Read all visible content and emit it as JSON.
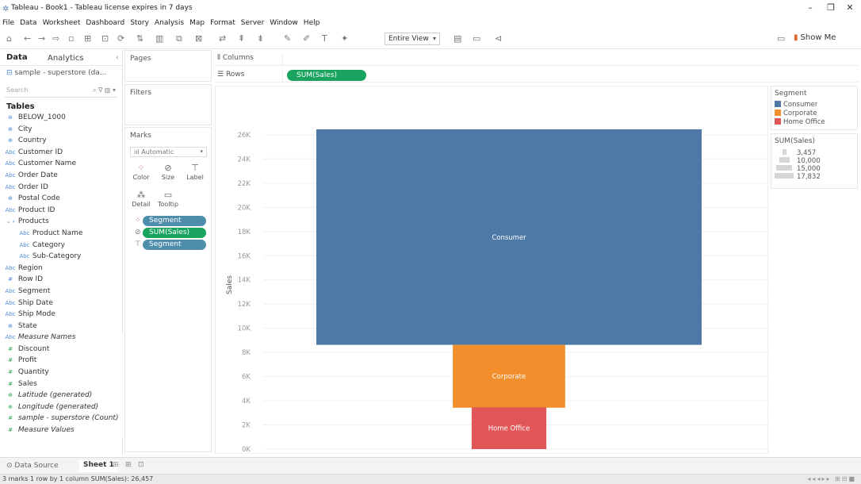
{
  "window": {
    "title": "Tableau - Book1 - Tableau license expires in 7 days",
    "controls": [
      "–",
      "❐",
      "✕"
    ]
  },
  "menu": [
    "File",
    "Data",
    "Worksheet",
    "Dashboard",
    "Story",
    "Analysis",
    "Map",
    "Format",
    "Server",
    "Window",
    "Help"
  ],
  "toolbar": {
    "view_select": "Entire View",
    "show_me": "Show Me"
  },
  "data_pane": {
    "tab_data": "Data",
    "tab_analytics": "Analytics",
    "datasource": "sample - superstore (da...",
    "search_placeholder": "Search",
    "tables_header": "Tables",
    "fields": [
      {
        "name": "BELOW_1000",
        "kind": "param",
        "indent": 0
      },
      {
        "name": "City",
        "kind": "geo",
        "indent": 0
      },
      {
        "name": "Country",
        "kind": "geo",
        "indent": 0
      },
      {
        "name": "Customer ID",
        "kind": "abc",
        "indent": 0
      },
      {
        "name": "Customer Name",
        "kind": "abc",
        "indent": 0
      },
      {
        "name": "Order Date",
        "kind": "abc",
        "indent": 0
      },
      {
        "name": "Order ID",
        "kind": "abc",
        "indent": 0
      },
      {
        "name": "Postal Code",
        "kind": "geo",
        "indent": 0
      },
      {
        "name": "Product ID",
        "kind": "abc",
        "indent": 0
      },
      {
        "name": "Products",
        "kind": "hier",
        "indent": 0
      },
      {
        "name": "Product Name",
        "kind": "abc",
        "indent": 1
      },
      {
        "name": "Category",
        "kind": "abc",
        "indent": 1
      },
      {
        "name": "Sub-Category",
        "kind": "abc",
        "indent": 1
      },
      {
        "name": "Region",
        "kind": "abc",
        "indent": 0
      },
      {
        "name": "Row ID",
        "kind": "num",
        "indent": 0
      },
      {
        "name": "Segment",
        "kind": "abc",
        "indent": 0
      },
      {
        "name": "Ship Date",
        "kind": "abc",
        "indent": 0
      },
      {
        "name": "Ship Mode",
        "kind": "abc",
        "indent": 0
      },
      {
        "name": "State",
        "kind": "geo",
        "indent": 0
      },
      {
        "name": "Measure Names",
        "kind": "abc",
        "indent": 0,
        "italic": true
      },
      {
        "name": "Discount",
        "kind": "mnum",
        "indent": 0
      },
      {
        "name": "Profit",
        "kind": "mnum",
        "indent": 0
      },
      {
        "name": "Quantity",
        "kind": "mnum",
        "indent": 0
      },
      {
        "name": "Sales",
        "kind": "mnum",
        "indent": 0
      },
      {
        "name": "Latitude (generated)",
        "kind": "mgeo",
        "indent": 0,
        "italic": true
      },
      {
        "name": "Longitude (generated)",
        "kind": "mgeo",
        "indent": 0,
        "italic": true
      },
      {
        "name": "sample - superstore (Count)",
        "kind": "mnum",
        "indent": 0,
        "italic": true
      },
      {
        "name": "Measure Values",
        "kind": "mnum",
        "indent": 0,
        "italic": true
      }
    ]
  },
  "cards": {
    "pages": "Pages",
    "filters": "Filters",
    "marks": "Marks",
    "mark_type": "Automatic",
    "buttons": {
      "color": "Color",
      "size": "Size",
      "label": "Label",
      "detail": "Detail",
      "tooltip": "Tooltip"
    },
    "pills": [
      "Segment",
      "SUM(Sales)",
      "Segment"
    ]
  },
  "shelves": {
    "columns_label": "Columns",
    "rows_label": "Rows",
    "rows_pill": "SUM(Sales)"
  },
  "legends": {
    "segment_title": "Segment",
    "segments": [
      {
        "name": "Consumer",
        "color": "#4e79a7"
      },
      {
        "name": "Corporate",
        "color": "#f28e2b"
      },
      {
        "name": "Home Office",
        "color": "#e15759"
      }
    ],
    "size_title": "SUM(Sales)",
    "size_items": [
      {
        "label": "3,457",
        "value": 3457
      },
      {
        "label": "10,000",
        "value": 10000
      },
      {
        "label": "15,000",
        "value": 15000
      },
      {
        "label": "17,832",
        "value": 17832
      }
    ]
  },
  "chart_data": {
    "type": "bar",
    "categories": [
      "Consumer",
      "Corporate",
      "Home Office"
    ],
    "values": [
      17832,
      5200,
      3457
    ],
    "stack_tops": [
      26457,
      8625,
      3457
    ],
    "colors": [
      "#4e79a7",
      "#f28e2b",
      "#e15759"
    ],
    "ylabel": "Sales",
    "ylim": [
      0,
      26457
    ],
    "yticks": [
      "0K",
      "2K",
      "4K",
      "6K",
      "8K",
      "10K",
      "12K",
      "14K",
      "16K",
      "18K",
      "20K",
      "22K",
      "24K",
      "26K"
    ],
    "grid": true
  },
  "bottom": {
    "datasource_tab": "Data Source",
    "sheet_tab": "Sheet 1",
    "status": "3 marks   1 row by 1 column   SUM(Sales): 26,457"
  }
}
